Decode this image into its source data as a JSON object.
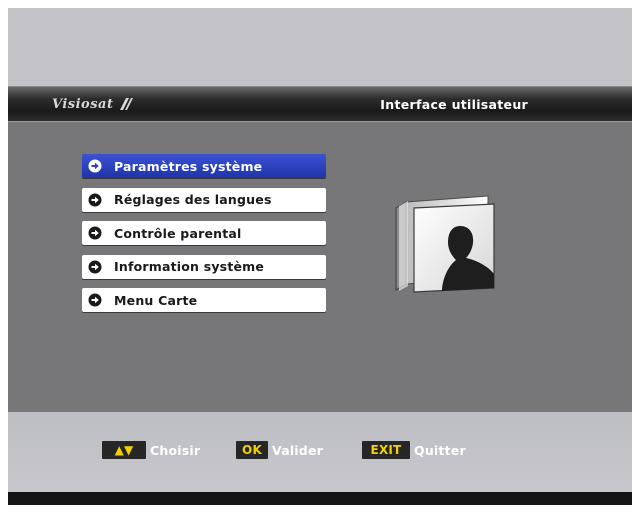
{
  "header": {
    "logo_text": "Visiosat",
    "title": "Interface utilisateur"
  },
  "menu": {
    "items": [
      {
        "label": "Paramètres système",
        "selected": true
      },
      {
        "label": "Réglages des langues",
        "selected": false
      },
      {
        "label": "Contrôle parental",
        "selected": false
      },
      {
        "label": "Information système",
        "selected": false
      },
      {
        "label": "Menu Carte",
        "selected": false
      }
    ]
  },
  "illustration": {
    "icon": "user-profile-icon"
  },
  "footer": {
    "hints": [
      {
        "key": "▲▼",
        "label": "Choisir"
      },
      {
        "key": "OK",
        "label": "Valider"
      },
      {
        "key": "EXIT",
        "label": "Quitter"
      }
    ]
  },
  "colors": {
    "selected_item": "#2a3fbf",
    "panel": "#777779",
    "key_text": "#f4d000",
    "footer": "#c3c3c8"
  }
}
